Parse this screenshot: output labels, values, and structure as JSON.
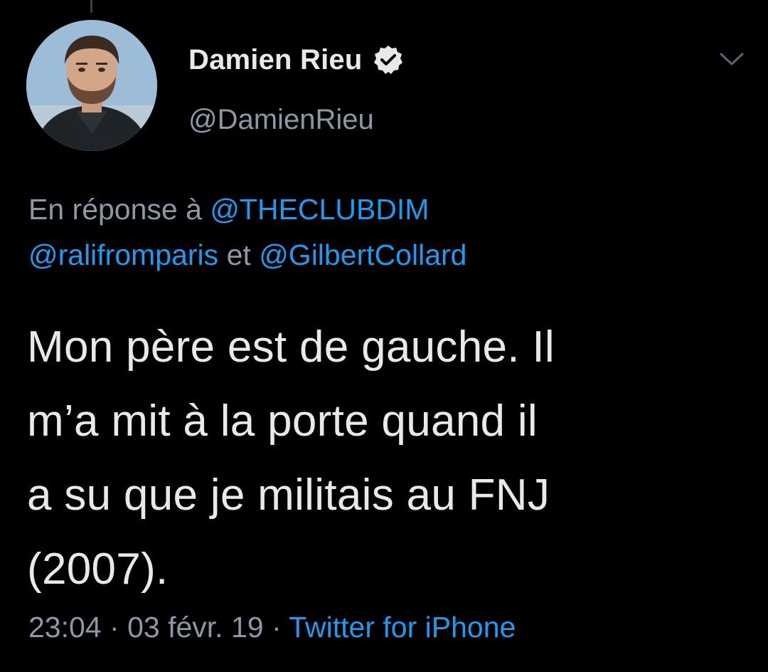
{
  "author": {
    "display_name": "Damien Rieu",
    "handle": "@DamienRieu",
    "verified": true
  },
  "icons": {
    "verified": "verified-badge-icon",
    "menu": "chevron-down-icon"
  },
  "reply": {
    "prefix": "En réponse à",
    "mention_1": "@THECLUBDIM",
    "mention_2": "@ralifromparis",
    "joiner": "et",
    "mention_3": "@GilbertCollard"
  },
  "tweet": {
    "lines": [
      "Mon père est de gauche. Il",
      "m’a mit à la porte quand il",
      "a su que je militais au FNJ",
      "(2007)."
    ]
  },
  "meta": {
    "time": "23:04",
    "separator": "·",
    "date": "03 févr. 19",
    "source": "Twitter for iPhone"
  },
  "colors": {
    "background": "#000000",
    "text": "#e7e9ea",
    "secondary": "#8b98a5",
    "link": "#1d9bf0"
  }
}
